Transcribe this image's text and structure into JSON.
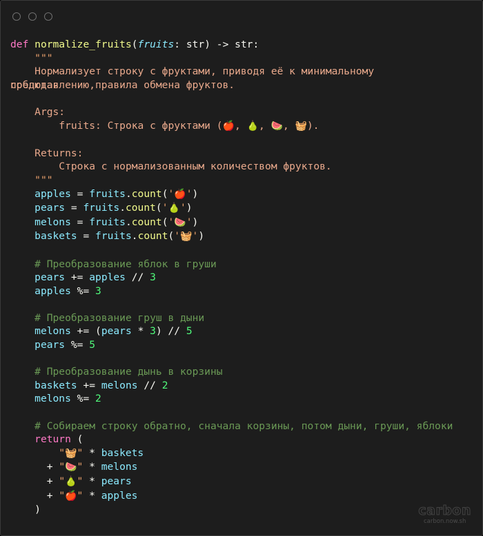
{
  "window": {
    "controls": [
      {
        "name": "close-dot",
        "color": "#6f6f6f"
      },
      {
        "name": "minimize-dot",
        "color": "#6f6f6f"
      },
      {
        "name": "maximize-dot",
        "color": "#6f6f6f"
      }
    ],
    "background": "#1d1d1d",
    "border_color": "#3a3a3a"
  },
  "theme": {
    "keyword": "#ff79c6",
    "function": "#f1fa8c",
    "parameter": "#8be9fd",
    "variable": "#8be9fd",
    "number": "#bd93f9",
    "string": "#e9a06c",
    "comment": "#6a9955",
    "plain": "#f8f8f2",
    "docstring": "#e9a98c"
  },
  "code": {
    "language": "python",
    "signature": {
      "keyword_def": "def",
      "name": "normalize_fruits",
      "param_name": "fruits",
      "param_type": "str",
      "arrow": "->",
      "return_type": "str",
      "colon": ":"
    },
    "docstring": {
      "open_quotes": "\"\"\"",
      "close_quotes": "\"\"\"",
      "summary_line_1": "Нормализует строку с фруктами, приводя её к минимальному",
      "summary_line_2_under": "представлению,",
      "summary_line_2_over": "соблюдая",
      "summary_line_2_tail": "правила обмена фруктов.",
      "args_heading": "Args:",
      "args_body_prefix": "fruits: Строка с фруктами (",
      "args_body_suffix": ").",
      "args_emojis": [
        "🍎",
        "🍐",
        "🍉",
        "🧺"
      ],
      "returns_heading": "Returns:",
      "returns_body": "Строка с нормализованным количеством фруктов."
    },
    "counts": [
      {
        "var": "apples",
        "call": "fruits.count",
        "emoji": "🍎"
      },
      {
        "var": "pears",
        "call": "fruits.count",
        "emoji": "🍐"
      },
      {
        "var": "melons",
        "call": "fruits.count",
        "emoji": "🍉"
      },
      {
        "var": "baskets",
        "call": "fruits.count",
        "emoji": "🧺"
      }
    ],
    "blocks": [
      {
        "comment": "# Преобразование яблок в груши",
        "lines": [
          "pears += apples // 3",
          "apples %= 3"
        ],
        "divisor": "3"
      },
      {
        "comment": "# Преобразование груш в дыни",
        "lines": [
          "melons += (pears * 3) // 5",
          "pears %= 5"
        ],
        "divisor": "5"
      },
      {
        "comment": "# Преобразование дынь в корзины",
        "lines": [
          "baskets += melons // 2",
          "melons %= 2"
        ],
        "divisor": "2"
      }
    ],
    "return_block": {
      "comment": "# Собираем строку обратно, сначала корзины, потом дыни, груши, яблоки",
      "keyword": "return",
      "open_paren": "(",
      "close_paren": ")",
      "terms": [
        {
          "plus": "",
          "emoji": "🧺",
          "op": "*",
          "var": "baskets"
        },
        {
          "plus": "+",
          "emoji": "🍉",
          "op": "*",
          "var": "melons"
        },
        {
          "plus": "+",
          "emoji": "🍐",
          "op": "*",
          "var": "pears"
        },
        {
          "plus": "+",
          "emoji": "🍎",
          "op": "*",
          "var": "apples"
        }
      ]
    }
  },
  "watermark": {
    "logo": "carbon",
    "url": "carbon.now.sh"
  }
}
